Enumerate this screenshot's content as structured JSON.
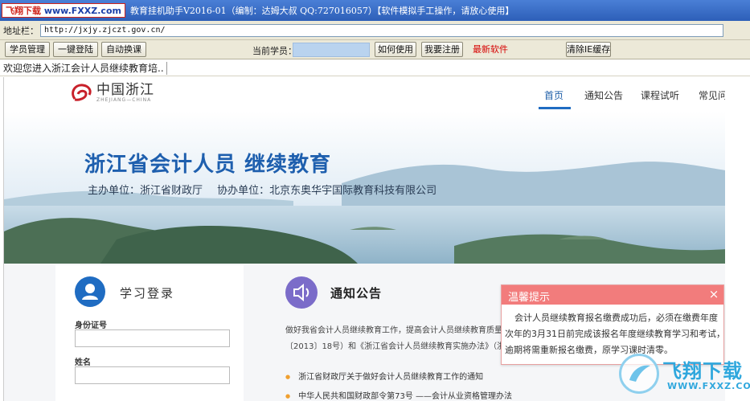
{
  "window": {
    "watermark_site": "飞翔下载",
    "watermark_url": "www.FXXZ.com",
    "title": "教育挂机助手V2016-01（编制：达姆大叔 QQ:727016057）【软件模拟手工操作，请放心使用】"
  },
  "address_bar": {
    "label": "地址栏：",
    "url": "http://jxjy.zjczt.gov.cn/"
  },
  "toolbar": {
    "student_manage": "学员管理",
    "one_click_login": "一键登陆",
    "auto_switch": "自动换课",
    "current_student_label": "当前学员：",
    "current_student_value": "",
    "how_to_use": "如何使用",
    "register": "我要注册",
    "latest_software": "最新软件",
    "clear_ie_cache": "清除IE缓存",
    "latest_software_color": "#d60000"
  },
  "status": {
    "message": "欢迎您进入浙江会计人员继续教育培.."
  },
  "site": {
    "logo_cn": "中国浙江",
    "logo_en": "ZHEJIANG—CHINA",
    "nav": [
      "首页",
      "通知公告",
      "课程试听",
      "常见问"
    ],
    "active_nav_color": "#1f5fa8",
    "banner_title": "浙江省会计人员 继续教育",
    "host_org": "主办单位：浙江省财政厅",
    "co_org": "协办单位：北京东奥华宇国际教育科技有限公司",
    "login": {
      "title": "学习登录",
      "id_label": "身份证号",
      "id_value": "",
      "name_label": "姓名",
      "name_value": ""
    },
    "notice": {
      "title": "通知公告",
      "body_lines": [
        "做好我省会计人员继续教育工作，提高会计人员继续教育质量，",
        "〔2013〕18号）和《浙江省会计人员继续教育实施办法》（浙财"
      ],
      "items": [
        "浙江省财政厅关于做好会计人员继续教育工作的通知",
        "中华人民共和国财政部令第73号 ——会计从业资格管理办法"
      ]
    }
  },
  "popup": {
    "title": "温馨提示",
    "close": "×",
    "lines": [
      "会计人员继续教育报名缴费成功后，必须在缴费年度",
      "次年的3月31日前完成该报名年度继续教育学习和考试，",
      "逾期将需重新报名缴费，原学习课时清零。"
    ],
    "header_color": "#f27c7c"
  },
  "corner_watermark": {
    "cn": "飞翔下载",
    "en": "WWW.FXXZ.COM"
  }
}
